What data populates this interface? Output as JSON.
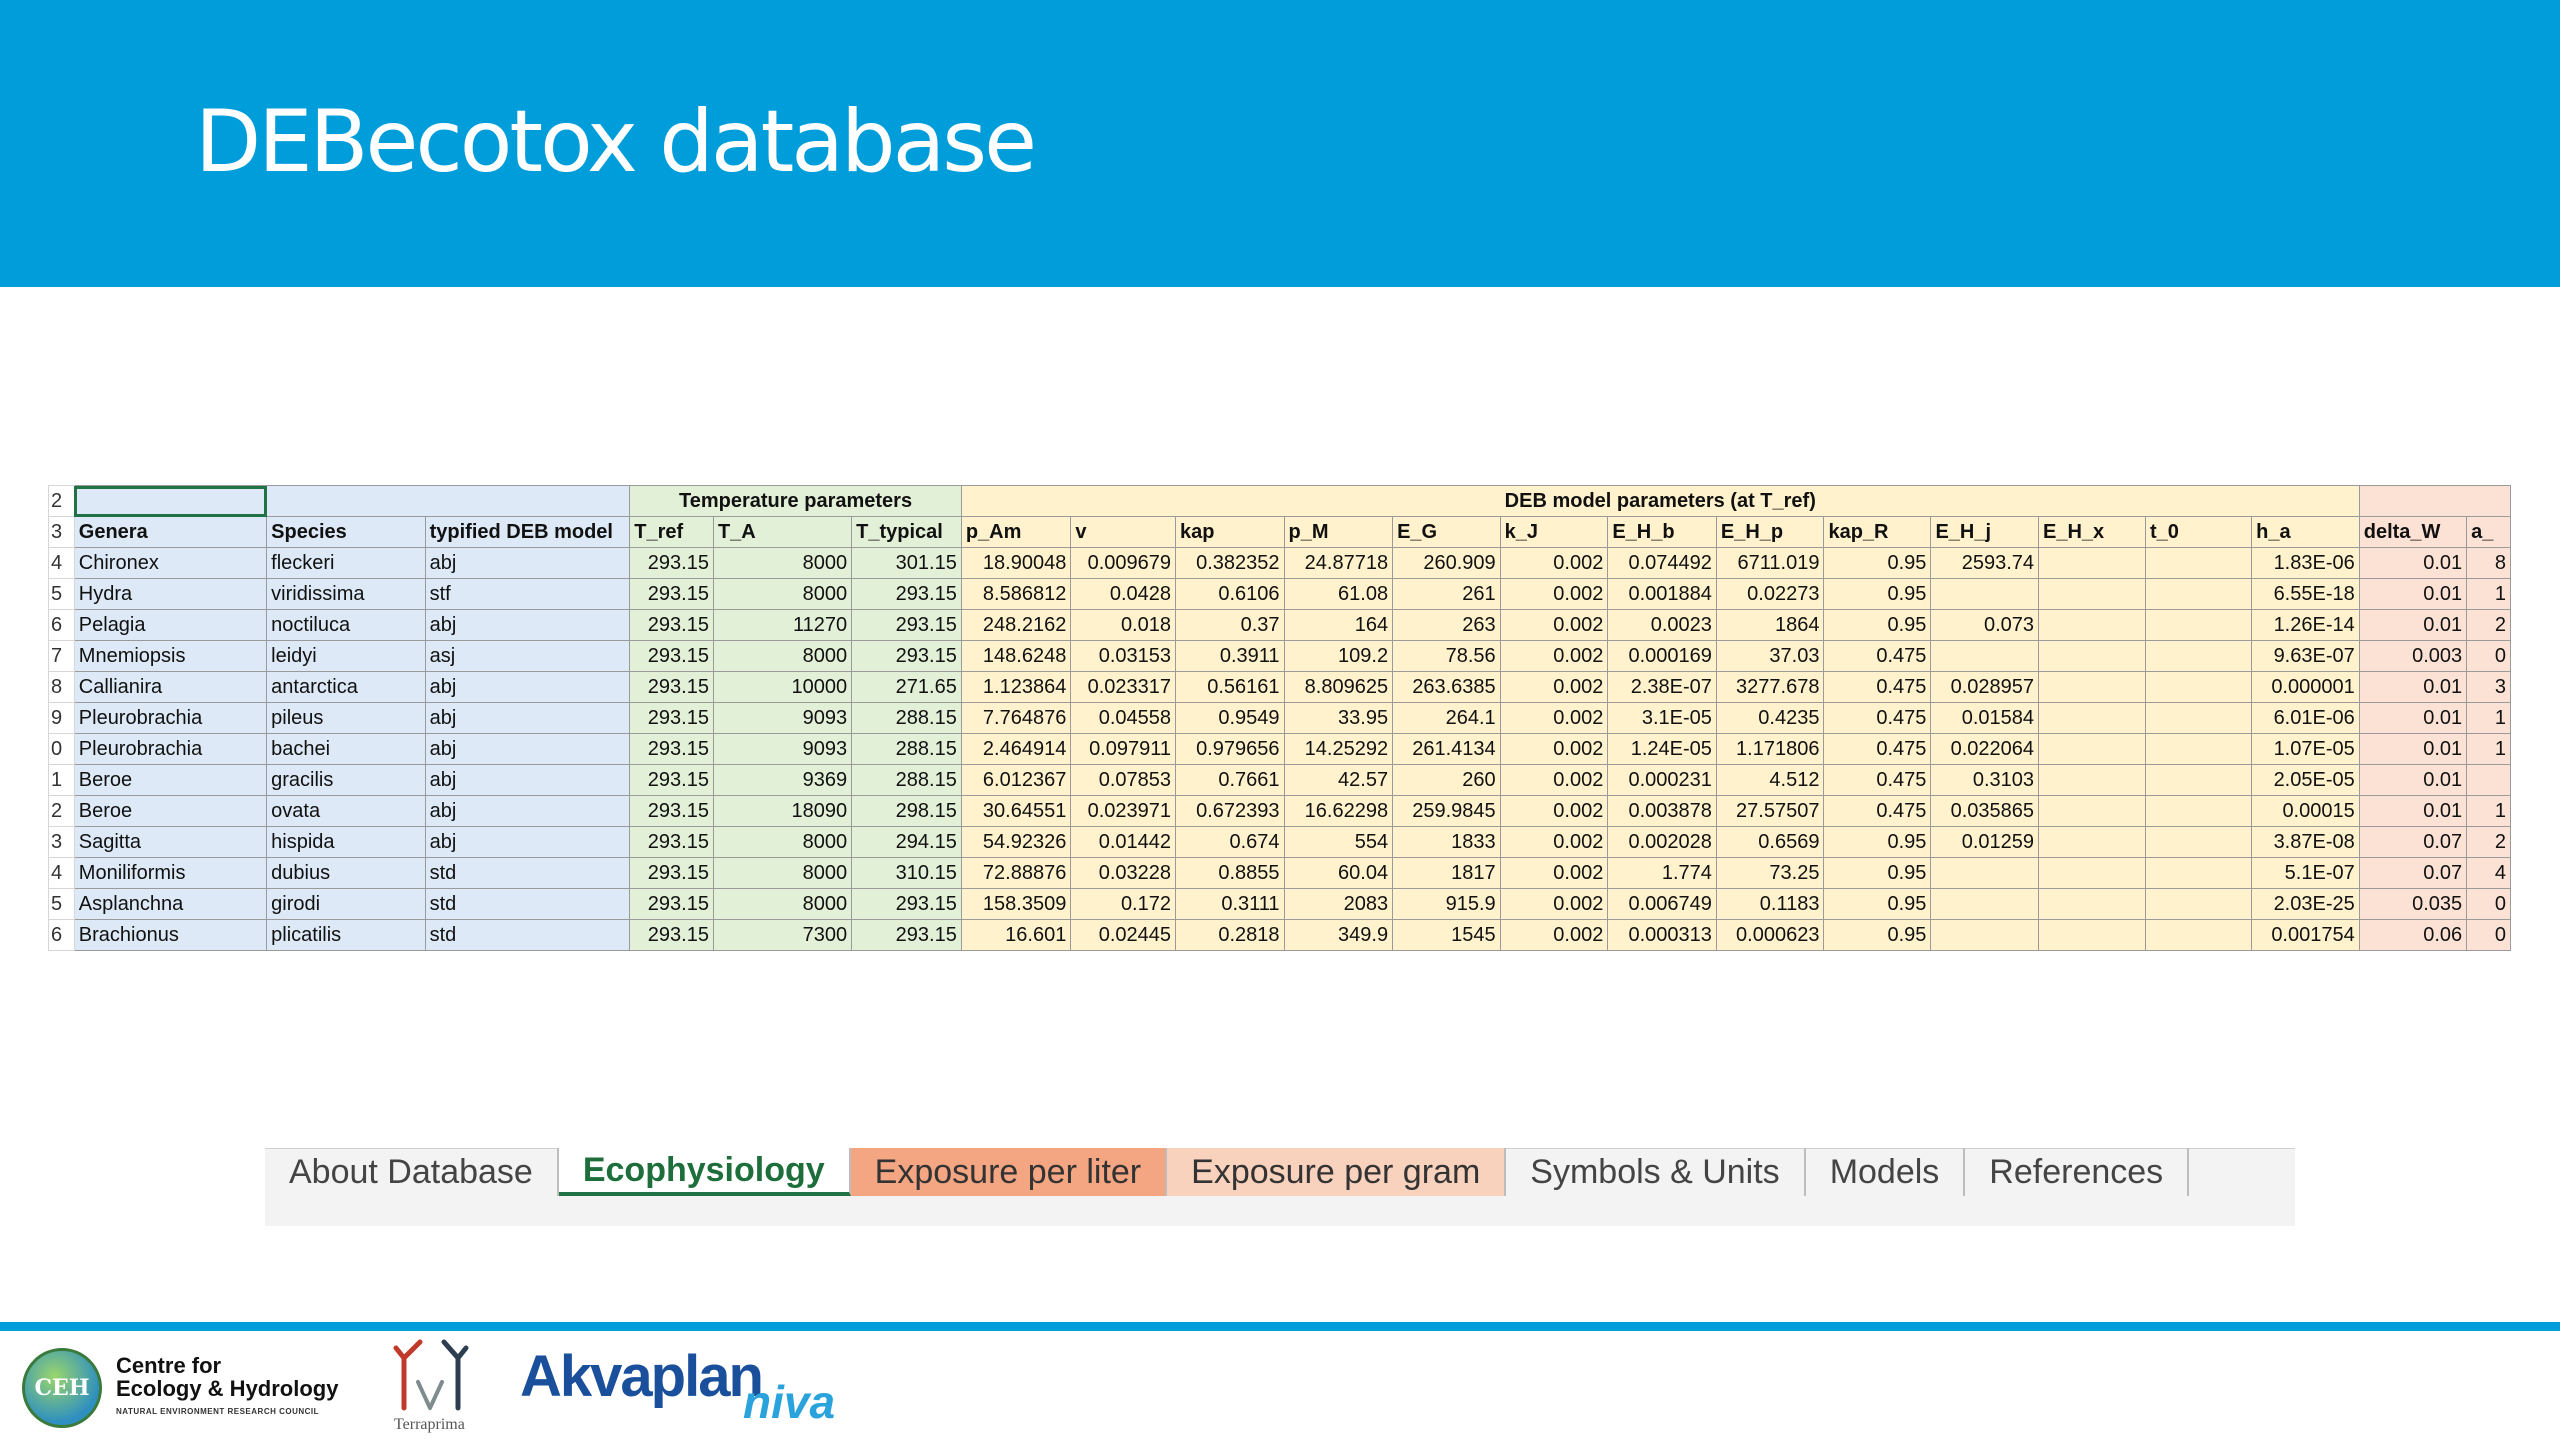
{
  "slide": {
    "title": "DEBecotox database"
  },
  "spreadsheet": {
    "row_numbers": [
      "2",
      "3",
      "4",
      "5",
      "6",
      "7",
      "8",
      "9",
      "0",
      "1",
      "2",
      "3",
      "4",
      "5",
      "6"
    ],
    "group_headers": {
      "temperature": "Temperature parameters",
      "deb": "DEB model parameters (at T_ref)"
    },
    "columns": [
      "Genera",
      "Species",
      "typified DEB model",
      "T_ref",
      "T_A",
      "T_typical",
      "p_Am",
      "v",
      "kap",
      "p_M",
      "E_G",
      "k_J",
      "E_H_b",
      "E_H_p",
      "kap_R",
      "E_H_j",
      "E_H_x",
      "t_0",
      "h_a",
      "delta_W",
      "a_"
    ],
    "rows": [
      [
        "Chironex",
        "fleckeri",
        "abj",
        "293.15",
        "8000",
        "301.15",
        "18.90048",
        "0.009679",
        "0.382352",
        "24.87718",
        "260.909",
        "0.002",
        "0.074492",
        "6711.019",
        "0.95",
        "2593.74",
        "",
        "",
        "1.83E-06",
        "0.01",
        "8"
      ],
      [
        "Hydra",
        "viridissima",
        "stf",
        "293.15",
        "8000",
        "293.15",
        "8.586812",
        "0.0428",
        "0.6106",
        "61.08",
        "261",
        "0.002",
        "0.001884",
        "0.02273",
        "0.95",
        "",
        "",
        "",
        "6.55E-18",
        "0.01",
        "1"
      ],
      [
        "Pelagia",
        "noctiluca",
        "abj",
        "293.15",
        "11270",
        "293.15",
        "248.2162",
        "0.018",
        "0.37",
        "164",
        "263",
        "0.002",
        "0.0023",
        "1864",
        "0.95",
        "0.073",
        "",
        "",
        "1.26E-14",
        "0.01",
        "2"
      ],
      [
        "Mnemiopsis",
        "leidyi",
        "asj",
        "293.15",
        "8000",
        "293.15",
        "148.6248",
        "0.03153",
        "0.3911",
        "109.2",
        "78.56",
        "0.002",
        "0.000169",
        "37.03",
        "0.475",
        "",
        "",
        "",
        "9.63E-07",
        "0.003",
        "0"
      ],
      [
        "Callianira",
        "antarctica",
        "abj",
        "293.15",
        "10000",
        "271.65",
        "1.123864",
        "0.023317",
        "0.56161",
        "8.809625",
        "263.6385",
        "0.002",
        "2.38E-07",
        "3277.678",
        "0.475",
        "0.028957",
        "",
        "",
        "0.000001",
        "0.01",
        "3"
      ],
      [
        "Pleurobrachia",
        "pileus",
        "abj",
        "293.15",
        "9093",
        "288.15",
        "7.764876",
        "0.04558",
        "0.9549",
        "33.95",
        "264.1",
        "0.002",
        "3.1E-05",
        "0.4235",
        "0.475",
        "0.01584",
        "",
        "",
        "6.01E-06",
        "0.01",
        "1"
      ],
      [
        "Pleurobrachia",
        "bachei",
        "abj",
        "293.15",
        "9093",
        "288.15",
        "2.464914",
        "0.097911",
        "0.979656",
        "14.25292",
        "261.4134",
        "0.002",
        "1.24E-05",
        "1.171806",
        "0.475",
        "0.022064",
        "",
        "",
        "1.07E-05",
        "0.01",
        "1"
      ],
      [
        "Beroe",
        "gracilis",
        "abj",
        "293.15",
        "9369",
        "288.15",
        "6.012367",
        "0.07853",
        "0.7661",
        "42.57",
        "260",
        "0.002",
        "0.000231",
        "4.512",
        "0.475",
        "0.3103",
        "",
        "",
        "2.05E-05",
        "0.01",
        ""
      ],
      [
        "Beroe",
        "ovata",
        "abj",
        "293.15",
        "18090",
        "298.15",
        "30.64551",
        "0.023971",
        "0.672393",
        "16.62298",
        "259.9845",
        "0.002",
        "0.003878",
        "27.57507",
        "0.475",
        "0.035865",
        "",
        "",
        "0.00015",
        "0.01",
        "1"
      ],
      [
        "Sagitta",
        "hispida",
        "abj",
        "293.15",
        "8000",
        "294.15",
        "54.92326",
        "0.01442",
        "0.674",
        "554",
        "1833",
        "0.002",
        "0.002028",
        "0.6569",
        "0.95",
        "0.01259",
        "",
        "",
        "3.87E-08",
        "0.07",
        "2"
      ],
      [
        "Moniliformis",
        "dubius",
        "std",
        "293.15",
        "8000",
        "310.15",
        "72.88876",
        "0.03228",
        "0.8855",
        "60.04",
        "1817",
        "0.002",
        "1.774",
        "73.25",
        "0.95",
        "",
        "",
        "",
        "5.1E-07",
        "0.07",
        "4"
      ],
      [
        "Asplanchna",
        "girodi",
        "std",
        "293.15",
        "8000",
        "293.15",
        "158.3509",
        "0.172",
        "0.3111",
        "2083",
        "915.9",
        "0.002",
        "0.006749",
        "0.1183",
        "0.95",
        "",
        "",
        "",
        "2.03E-25",
        "0.035",
        "0"
      ],
      [
        "Brachionus",
        "plicatilis",
        "std",
        "293.15",
        "7300",
        "293.15",
        "16.601",
        "0.02445",
        "0.2818",
        "349.9",
        "1545",
        "0.002",
        "0.000313",
        "0.000623",
        "0.95",
        "",
        "",
        "",
        "0.001754",
        "0.06",
        "0"
      ]
    ]
  },
  "sheet_tabs": [
    {
      "label": "About Database",
      "state": "normal"
    },
    {
      "label": "Ecophysiology",
      "state": "active"
    },
    {
      "label": "Exposure per liter",
      "state": "orange"
    },
    {
      "label": "Exposure per gram",
      "state": "peach"
    },
    {
      "label": "Symbols & Units",
      "state": "normal"
    },
    {
      "label": "Models",
      "state": "normal"
    },
    {
      "label": "References",
      "state": "normal"
    }
  ],
  "footer": {
    "ceh_logo": {
      "emblem": "CEH",
      "line1": "Centre for",
      "line2": "Ecology & Hydrology",
      "line3": "NATURAL ENVIRONMENT RESEARCH COUNCIL"
    },
    "terraprima_logo": {
      "text": "Terraprima"
    },
    "akvaplan_logo": {
      "main": "Akvaplan",
      "sub": "niva"
    }
  },
  "colors": {
    "banner": "#009ddb",
    "sheet_blue": "#dde9f6",
    "sheet_green": "#e3f0d8",
    "sheet_yellow": "#fff2cc",
    "sheet_pink": "#fbe2d5",
    "active_tab": "#217346",
    "akvaplan_blue": "#1a4f9c",
    "niva_blue": "#2aa3dc"
  }
}
